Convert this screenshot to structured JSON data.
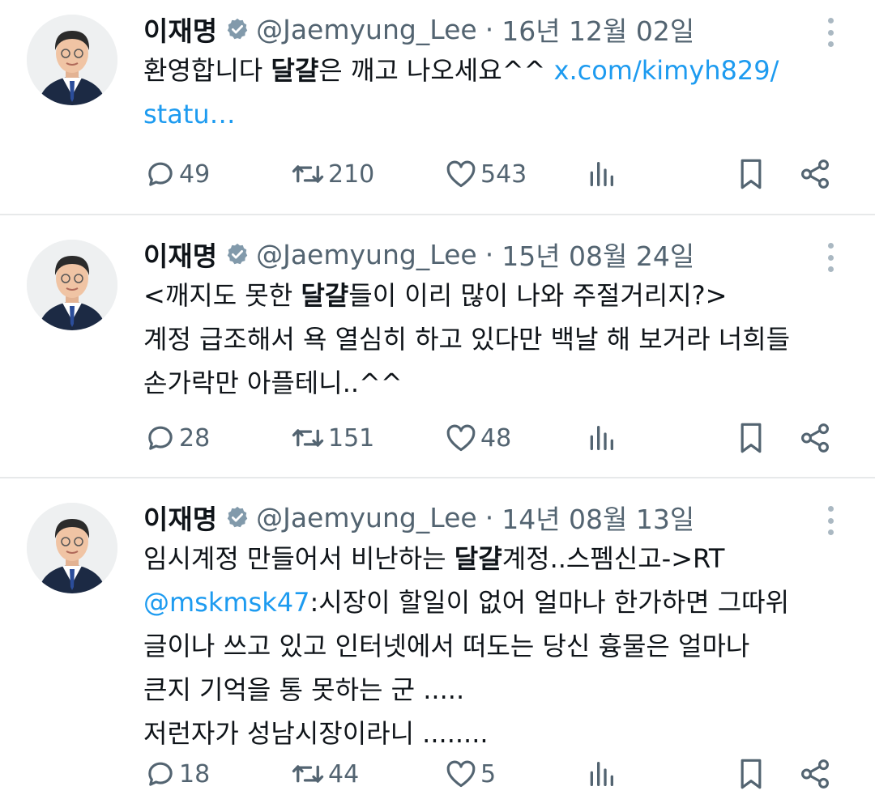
{
  "tweets": [
    {
      "author": {
        "name": "이재명",
        "handle": "@Jaemyung_Lee",
        "avatar": "profile-photo-man-suit"
      },
      "date": "16년 12월 02일",
      "lines": [
        [
          {
            "text": "환영합니다 "
          },
          {
            "text": "달걀",
            "bold": true
          },
          {
            "text": "은 깨고 나오세요^^ "
          },
          {
            "text": "x.com/kimyh829/",
            "link": true
          }
        ],
        [
          {
            "text": "statu…",
            "link": true
          }
        ]
      ],
      "stats": {
        "replies": "49",
        "retweets": "210",
        "likes": "543"
      }
    },
    {
      "author": {
        "name": "이재명",
        "handle": "@Jaemyung_Lee",
        "avatar": "profile-photo-man-suit"
      },
      "date": "15년 08월 24일",
      "lines": [
        [
          {
            "text": "<깨지도 못한 "
          },
          {
            "text": "달걀",
            "bold": true
          },
          {
            "text": "들이 이리 많이 나와 주절거리지?>"
          }
        ],
        [
          {
            "text": "계정 급조해서 욕 열심히 하고 있다만 백날 해 보거라 너희들"
          }
        ],
        [
          {
            "text": "손가락만 아플테니..^^"
          }
        ]
      ],
      "stats": {
        "replies": "28",
        "retweets": "151",
        "likes": "48"
      }
    },
    {
      "author": {
        "name": "이재명",
        "handle": "@Jaemyung_Lee",
        "avatar": "profile-photo-man-suit"
      },
      "date": "14년 08월 13일",
      "lines": [
        [
          {
            "text": "임시계정 만들어서 비난하는 "
          },
          {
            "text": "달걀",
            "bold": true
          },
          {
            "text": "계정..스펨신고->RT"
          }
        ],
        [
          {
            "text": "@mskmsk47",
            "link": true
          },
          {
            "text": ":시장이 할일이 없어 얼마나 한가하면 그따위"
          }
        ],
        [
          {
            "text": "글이나 쓰고 있고 인터넷에서 떠도는 당신 흉물은 얼마나"
          }
        ],
        [
          {
            "text": "큰지 기억을 통 못하는 군 ....."
          }
        ],
        [
          {
            "text": "저런자가 성남시장이라니 ........"
          }
        ]
      ],
      "stats": {
        "replies": "18",
        "retweets": "44",
        "likes": "5"
      }
    }
  ],
  "icons": {
    "verified": "verified-badge-icon",
    "more": "more-options-icon",
    "reply": "reply-icon",
    "retweet": "retweet-icon",
    "like": "heart-icon",
    "views": "views-chart-icon",
    "bookmark": "bookmark-icon",
    "share": "share-icon"
  },
  "colors": {
    "link": "#1d9bf0",
    "secondary_text": "#536471",
    "divider": "#e7e9ea",
    "verified_badge": "#829aab"
  }
}
